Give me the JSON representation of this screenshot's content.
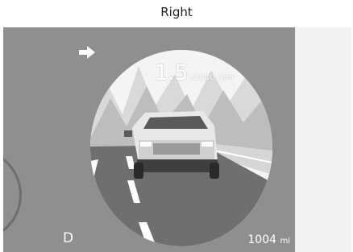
{
  "caption": "Right",
  "cluster": {
    "rpm_value": "1.5",
    "rpm_unit": "x1000 rpm",
    "gear": "D",
    "odometer_value": "1004",
    "odometer_unit": "mi",
    "turn_signal_icon": "right-arrow-icon"
  },
  "colors": {
    "screen_bg": "#8f8f8f",
    "text": "#ffffff"
  }
}
